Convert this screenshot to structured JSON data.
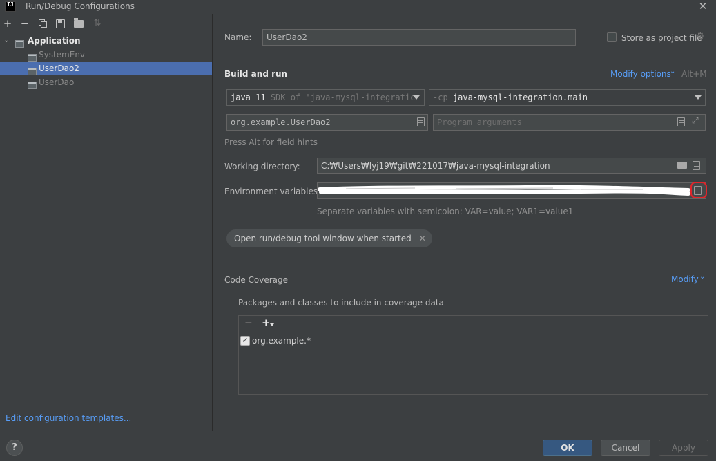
{
  "window": {
    "logo_text": "IJ",
    "title": "Run/Debug Configurations",
    "close_glyph": "✕"
  },
  "left": {
    "toolbar": {
      "add_glyph": "+",
      "remove_glyph": "−",
      "sort_glyph": "⇅"
    },
    "tree": {
      "root": {
        "label": "Application",
        "expanded": true
      },
      "items": [
        {
          "label": "SystemEnv",
          "selected": false
        },
        {
          "label": "UserDao2",
          "selected": true
        },
        {
          "label": "UserDao",
          "selected": false
        }
      ]
    },
    "edit_templates_link": "Edit configuration templates..."
  },
  "form": {
    "name_label": "Name:",
    "name_value": "UserDao2",
    "store_as_project_file": {
      "label": "Store as project file",
      "checked": false
    },
    "build_and_run": {
      "heading": "Build and run",
      "modify_options_label": "Modify options",
      "modify_options_shortcut": "Alt+M",
      "jdk_version": "java 11",
      "jdk_hint": "SDK of 'java-mysql-integratic",
      "classpath_flag": "-cp",
      "classpath_value": "java-mysql-integration.main",
      "main_class": "org.example.UserDao2",
      "program_args_placeholder": "Program arguments",
      "field_hint": "Press Alt for field hints"
    },
    "working_directory": {
      "label": "Working directory:",
      "value": "C:₩Users₩lyj19₩git₩221017₩java-mysql-integration"
    },
    "env_vars": {
      "label": "Environment variables:",
      "value": "",
      "hint": "Separate variables with semicolon: VAR=value; VAR1=value1"
    },
    "open_tool_window_chip": "Open run/debug tool window when started",
    "code_coverage": {
      "heading": "Code Coverage",
      "modify_label": "Modify",
      "packages_label": "Packages and classes to include in coverage data",
      "remove_glyph": "−",
      "add_glyph": "+",
      "entries": [
        {
          "label": "org.example.*",
          "checked": true
        }
      ]
    }
  },
  "footer": {
    "help_glyph": "?",
    "ok": "OK",
    "cancel": "Cancel",
    "apply": "Apply"
  },
  "colors": {
    "background": "#3c3f41",
    "selection": "#4b6eaf",
    "link": "#589df6",
    "primary_button": "#365880",
    "highlight_circle": "#e0252b"
  }
}
